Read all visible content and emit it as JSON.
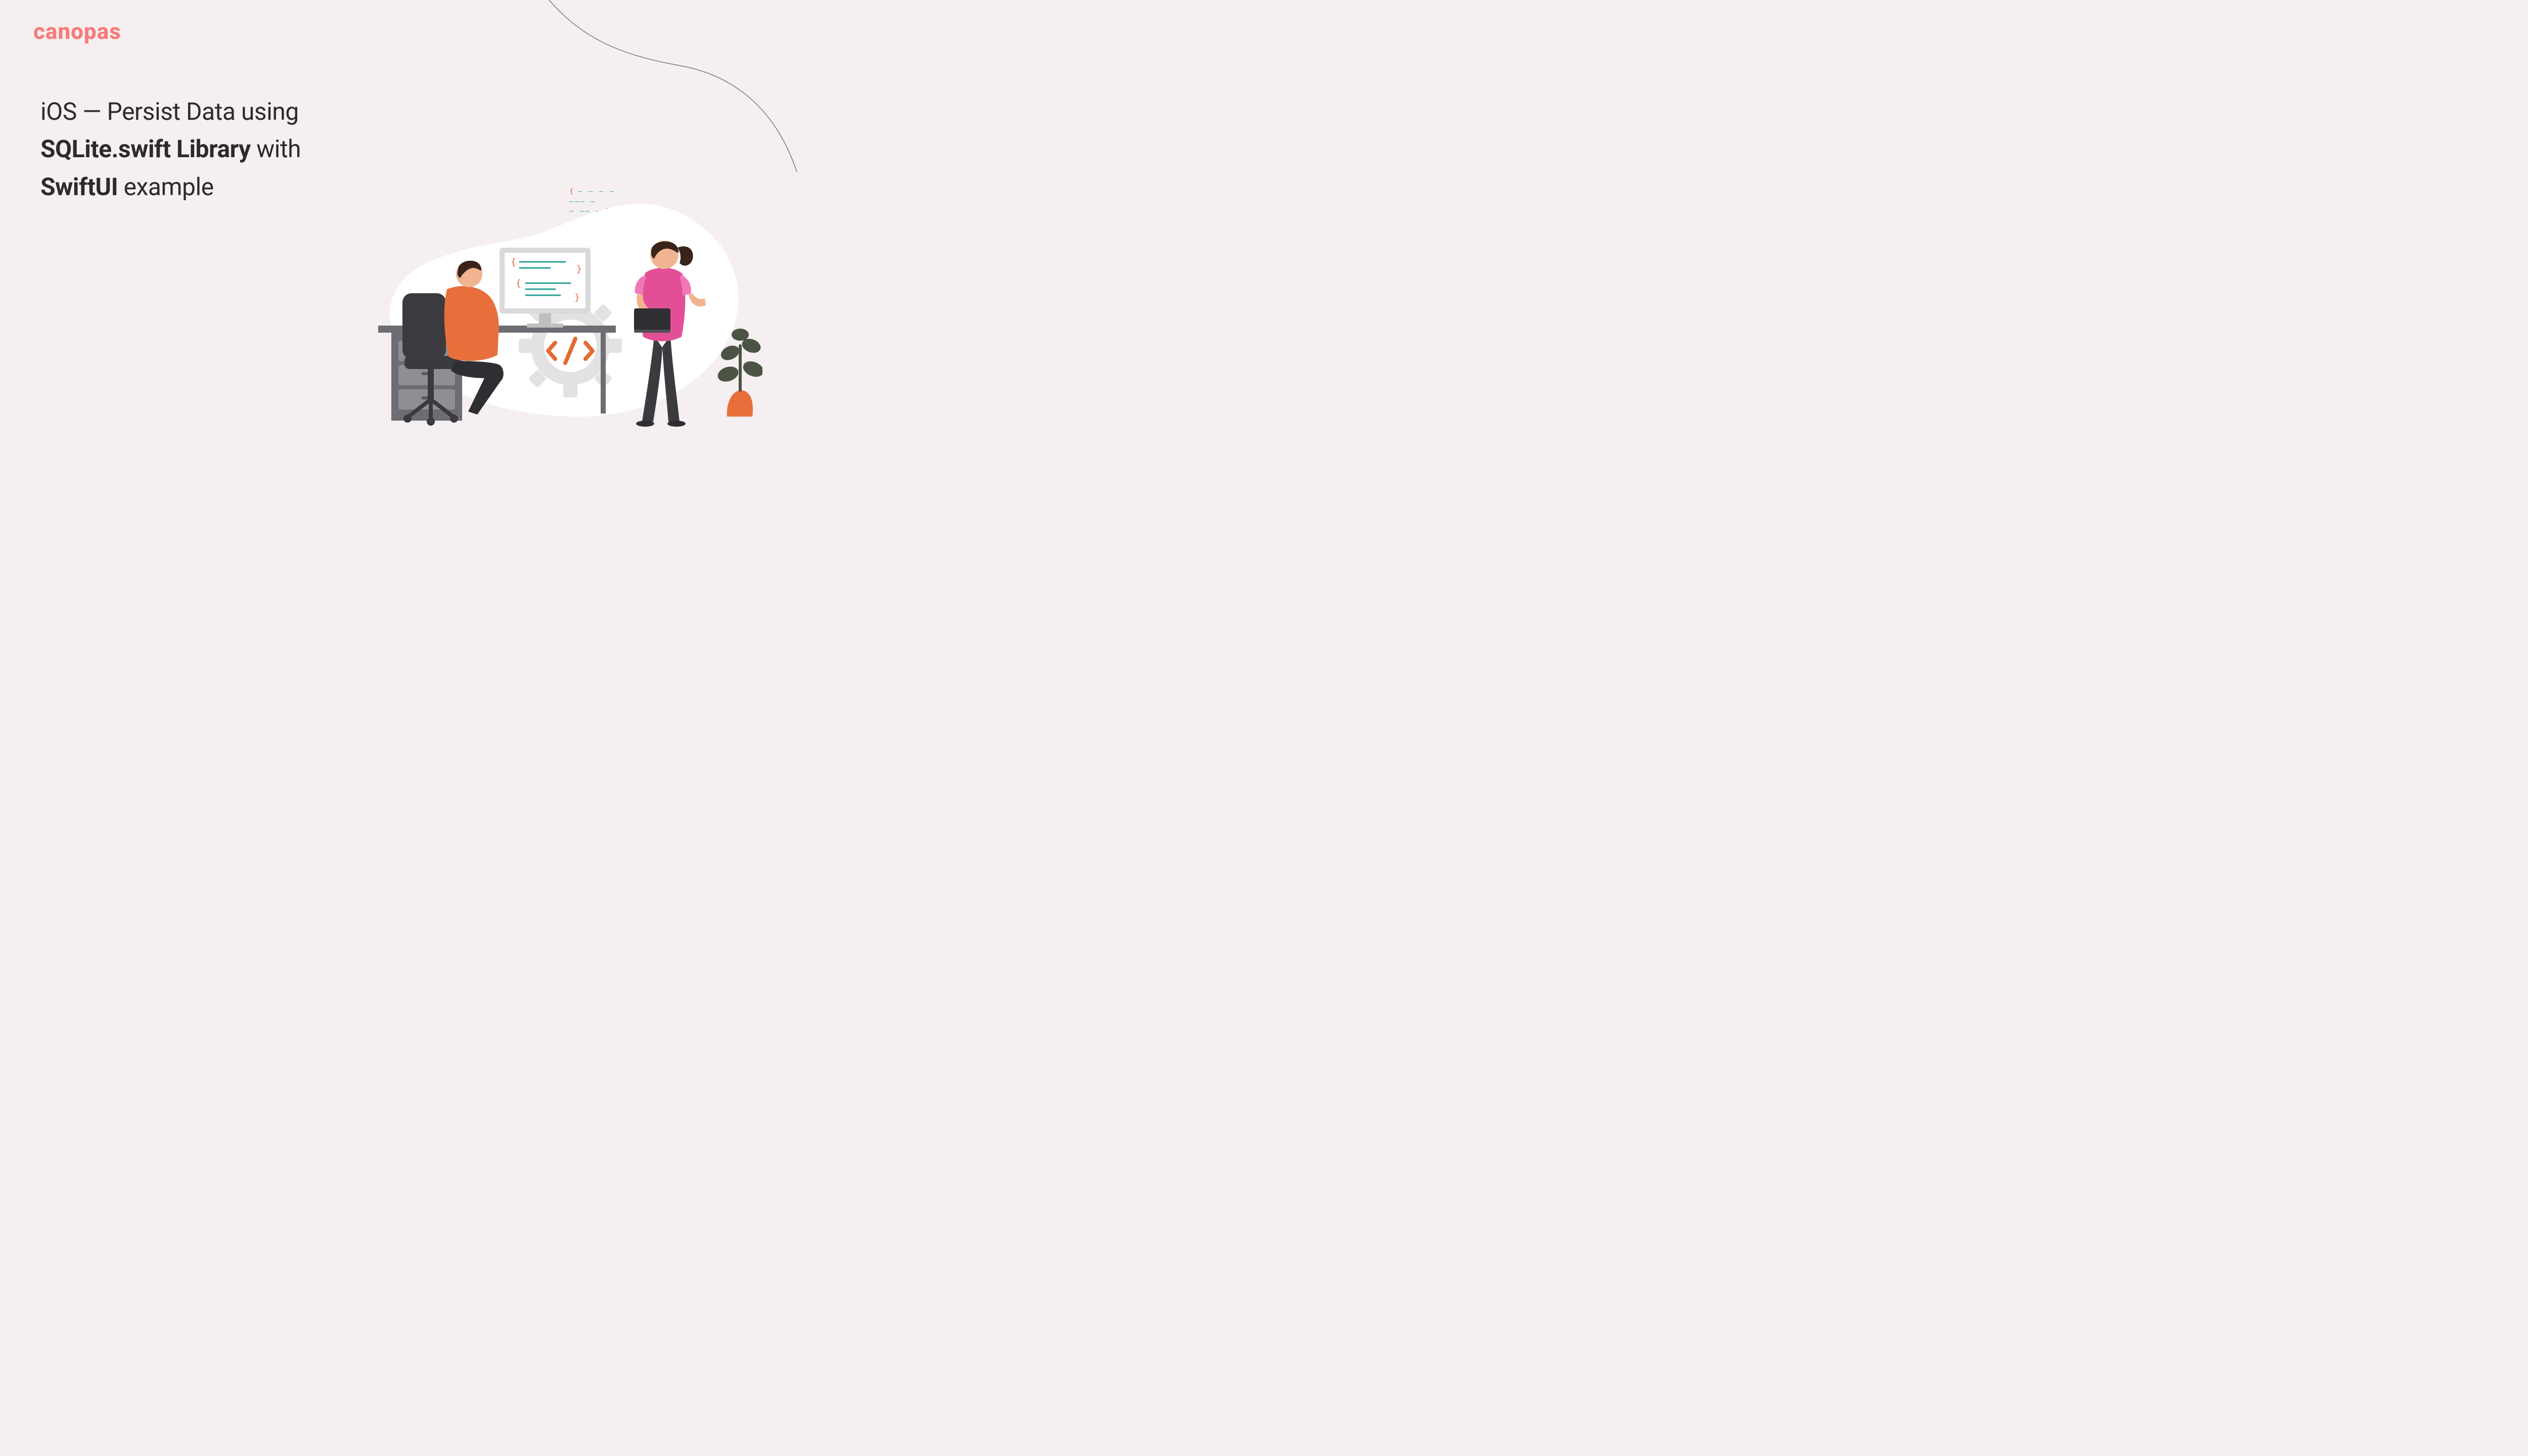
{
  "brand": {
    "name": "canopas"
  },
  "headline": {
    "line1_pre": "iOS — Persist Data using",
    "line2_bold": "SQLite.swift Library",
    "line2_post": " with",
    "line3_bold": "SwiftUI",
    "line3_post": " example"
  },
  "snippet": {
    "open": "{",
    "close": "}"
  },
  "palette": {
    "bg": "#f6eff1",
    "accent": "#f97a7a",
    "teal": "#2aa198",
    "orange": "#e36b32",
    "pink": "#e24f97",
    "dark": "#3b3b3f"
  }
}
